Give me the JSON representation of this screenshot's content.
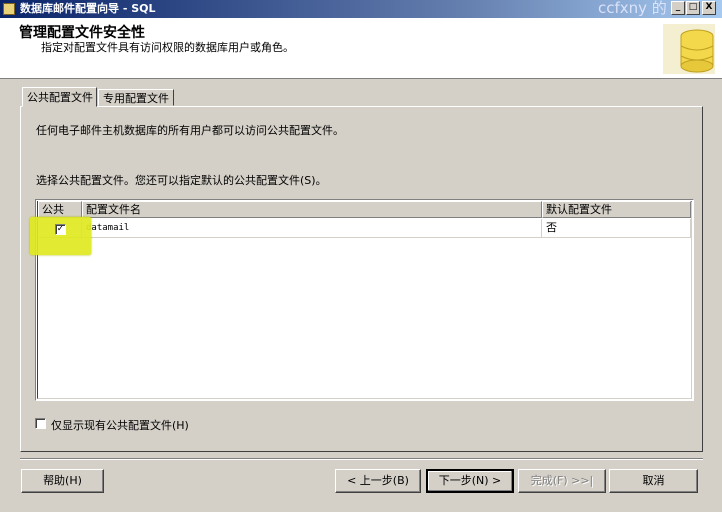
{
  "window": {
    "title": "数据库邮件配置向导 - SQL",
    "watermark": "ccfxny 的",
    "controls": [
      "_",
      "□",
      "X"
    ]
  },
  "header": {
    "title": "管理配置文件安全性",
    "subtitle": "指定对配置文件具有访问权限的数据库用户或角色。"
  },
  "tabs": [
    {
      "label": "公共配置文件",
      "active": true
    },
    {
      "label": "专用配置文件",
      "active": false
    }
  ],
  "panel": {
    "intro": "任何电子邮件主机数据库的所有用户都可以访问公共配置文件。",
    "prompt": "选择公共配置文件。您还可以指定默认的公共配置文件(S)。"
  },
  "grid": {
    "columns": [
      "公共",
      "配置文件名",
      "默认配置文件"
    ],
    "rows": [
      {
        "public": true,
        "profile_name": "datamail",
        "default": "否"
      }
    ]
  },
  "bottom_option": {
    "label": "仅显示现有公共配置文件(H)",
    "checked": false
  },
  "buttons": {
    "help": "帮助(H)",
    "back": "< 上一步(B)",
    "next": "下一步(N) >",
    "finish": "完成(F) >>|",
    "cancel": "取消"
  },
  "colors": {
    "highlight": "#e0ea20",
    "titlebar": "#0a246a",
    "dialog": "#d4d0c8"
  }
}
